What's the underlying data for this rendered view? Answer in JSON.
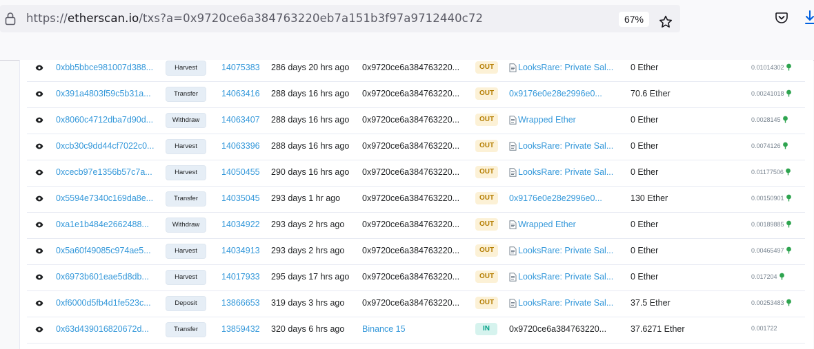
{
  "browser": {
    "url_scheme": "https://",
    "url_host": "etherscan.io",
    "url_path": "/txs?a=0x9720ce6a384763220eb7a151b3f97a9712440c72",
    "zoom": "67%"
  },
  "colors": {
    "link": "#3498da",
    "out_bg": "#fcf1d6",
    "out_text": "#b47d00",
    "in_bg": "#d6f3ee",
    "in_text": "#00a186",
    "gas": "#2ea44f"
  },
  "rows": [
    {
      "hash": "0xbb5bbce981007d388...",
      "method": "Harvest",
      "block": "14075383",
      "age": "286 days 20 hrs ago",
      "from": "0x9720ce6a384763220...",
      "direction": "OUT",
      "to": "LooksRare: Private Sal...",
      "to_is_contract": true,
      "value": "0 Ether",
      "fee": "0.01014302",
      "gas_icon": true
    },
    {
      "hash": "0x391a4803f59c5b31a...",
      "method": "Transfer",
      "block": "14063416",
      "age": "288 days 16 hrs ago",
      "from": "0x9720ce6a384763220...",
      "direction": "OUT",
      "to": "0x9176e0e28e2996e0...",
      "to_is_contract": false,
      "value": "70.6 Ether",
      "fee": "0.00241018",
      "gas_icon": true
    },
    {
      "hash": "0x8060c4712dba7d90d...",
      "method": "Withdraw",
      "block": "14063407",
      "age": "288 days 16 hrs ago",
      "from": "0x9720ce6a384763220...",
      "direction": "OUT",
      "to": "Wrapped Ether",
      "to_is_contract": true,
      "value": "0 Ether",
      "fee": "0.0028145",
      "gas_icon": true
    },
    {
      "hash": "0xcb30c9dd44cf7022c0...",
      "method": "Harvest",
      "block": "14063396",
      "age": "288 days 16 hrs ago",
      "from": "0x9720ce6a384763220...",
      "direction": "OUT",
      "to": "LooksRare: Private Sal...",
      "to_is_contract": true,
      "value": "0 Ether",
      "fee": "0.0074126",
      "gas_icon": true
    },
    {
      "hash": "0xcecb97e1356b57c7a...",
      "method": "Harvest",
      "block": "14050455",
      "age": "290 days 16 hrs ago",
      "from": "0x9720ce6a384763220...",
      "direction": "OUT",
      "to": "LooksRare: Private Sal...",
      "to_is_contract": true,
      "value": "0 Ether",
      "fee": "0.01177506",
      "gas_icon": true
    },
    {
      "hash": "0x5594e7340c169da8e...",
      "method": "Transfer",
      "block": "14035045",
      "age": "293 days 1 hr ago",
      "from": "0x9720ce6a384763220...",
      "direction": "OUT",
      "to": "0x9176e0e28e2996e0...",
      "to_is_contract": false,
      "value": "130 Ether",
      "fee": "0.00150901",
      "gas_icon": true
    },
    {
      "hash": "0xa1e1b484e2662488...",
      "method": "Withdraw",
      "block": "14034922",
      "age": "293 days 2 hrs ago",
      "from": "0x9720ce6a384763220...",
      "direction": "OUT",
      "to": "Wrapped Ether",
      "to_is_contract": true,
      "value": "0 Ether",
      "fee": "0.00189885",
      "gas_icon": true
    },
    {
      "hash": "0x5a60f49085c974ae5...",
      "method": "Harvest",
      "block": "14034913",
      "age": "293 days 2 hrs ago",
      "from": "0x9720ce6a384763220...",
      "direction": "OUT",
      "to": "LooksRare: Private Sal...",
      "to_is_contract": true,
      "value": "0 Ether",
      "fee": "0.00465497",
      "gas_icon": true
    },
    {
      "hash": "0x6973b601eae5d8db...",
      "method": "Harvest",
      "block": "14017933",
      "age": "295 days 17 hrs ago",
      "from": "0x9720ce6a384763220...",
      "direction": "OUT",
      "to": "LooksRare: Private Sal...",
      "to_is_contract": true,
      "value": "0 Ether",
      "fee": "0.017204",
      "gas_icon": true
    },
    {
      "hash": "0xf6000d5fb4d1fe523c...",
      "method": "Deposit",
      "block": "13866653",
      "age": "319 days 3 hrs ago",
      "from": "0x9720ce6a384763220...",
      "direction": "OUT",
      "to": "LooksRare: Private Sal...",
      "to_is_contract": true,
      "value": "37.5 Ether",
      "fee": "0.00253483",
      "gas_icon": true
    },
    {
      "hash": "0x63d439016820672d...",
      "method": "Transfer",
      "block": "13859432",
      "age": "320 days 6 hrs ago",
      "from": "Binance 15",
      "from_is_link": true,
      "direction": "IN",
      "to": "0x9720ce6a384763220...",
      "to_is_contract": false,
      "to_is_plain": true,
      "value": "37.6271 Ether",
      "fee": "0.001722",
      "gas_icon": false
    }
  ]
}
